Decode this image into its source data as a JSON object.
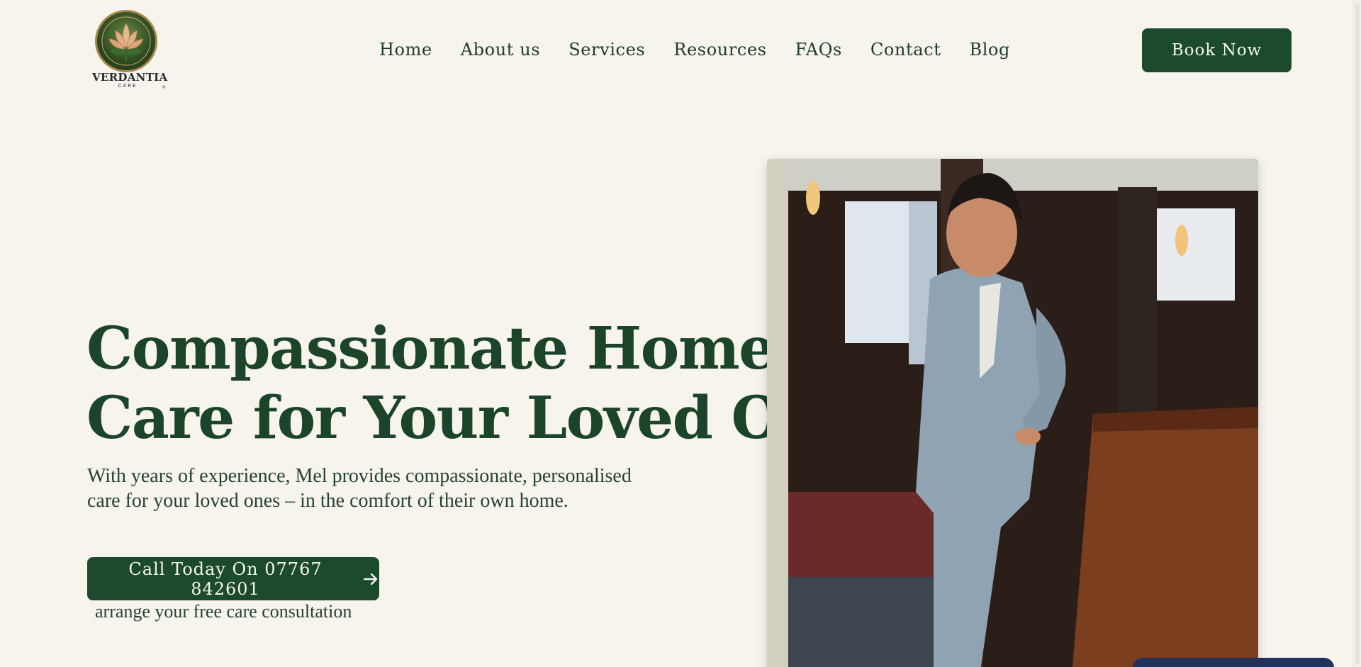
{
  "brand": {
    "name": "VERDANTIA",
    "tagline": "CARE",
    "trademark": "®"
  },
  "nav": {
    "items": [
      {
        "label": "Home"
      },
      {
        "label": "About us"
      },
      {
        "label": "Services"
      },
      {
        "label": "Resources"
      },
      {
        "label": "FAQs"
      },
      {
        "label": "Contact"
      },
      {
        "label": "Blog"
      }
    ],
    "cta_label": "Book Now"
  },
  "hero": {
    "title_line1": "Compassionate Home",
    "title_line2": "Care for Your Loved Ones",
    "subtitle": "With years of experience, Mel provides compassionate, personalised care for your loved ones – in the comfort of their own home.",
    "call_label": "Call Today On 07767 842601",
    "call_note": "arrange your free care consultation"
  },
  "icons": {
    "logo": "lotus-emblem-icon",
    "call_arrow": "arrow-right-icon"
  },
  "colors": {
    "background": "#f7f4ee",
    "primary_green": "#1b4a2c",
    "text_green": "#1b4429",
    "button_text": "#f7f4ee",
    "chat_widget": "#22325a"
  }
}
